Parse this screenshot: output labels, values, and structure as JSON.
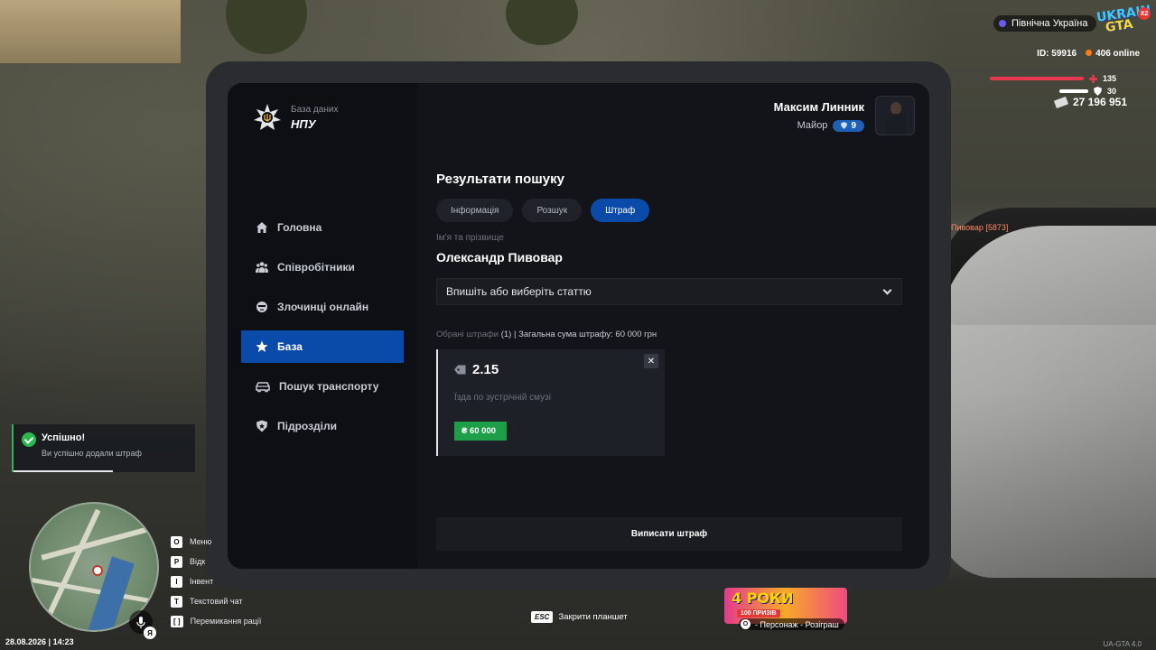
{
  "hud": {
    "region": "Північна Україна",
    "logo_line1": "UKRAIN",
    "logo_line2": "GTA",
    "logo_badge": "X2",
    "player_id": "ID: 59916",
    "online": "406 online",
    "health": "135",
    "armor": "30",
    "money": "27 196 951",
    "npc_label": "Пивовар [5873]",
    "colors": {
      "health": "#e53950",
      "armor": "#ffffff",
      "online_dot": "#ff7a1a"
    }
  },
  "tablet": {
    "brand": {
      "small": "База даних",
      "big": "НПУ"
    },
    "user": {
      "name": "Максим Линник",
      "rank": "Майор",
      "level": "9"
    },
    "nav": [
      {
        "label": "Головна",
        "icon": "home-icon",
        "active": false
      },
      {
        "label": "Співробітники",
        "icon": "people-icon",
        "active": false
      },
      {
        "label": "Злочинці онлайн",
        "icon": "criminal-icon",
        "active": false
      },
      {
        "label": "База",
        "icon": "star-icon",
        "active": true
      },
      {
        "label": "Пошук транспорту",
        "icon": "car-icon",
        "active": false
      },
      {
        "label": "Підрозділи",
        "icon": "shield-icon",
        "active": false
      }
    ],
    "title": "Результати пошуку",
    "tabs": [
      {
        "label": "Інформація",
        "active": false
      },
      {
        "label": "Розшук",
        "active": false
      },
      {
        "label": "Штраф",
        "active": true
      }
    ],
    "name_label": "Ім'я та прізвище",
    "name_value": "Олександр Пивовар",
    "select_placeholder": "Впишіть або виберіть статтю",
    "summary": {
      "label": "Обрані штрафи",
      "count": "(1)",
      "total": " | Загальна сума штрафу: 60 000 грн"
    },
    "fines": [
      {
        "code": "2.15",
        "description": "Їзда по зустрічній смузі",
        "amount": "₴ 60 000",
        "close": "✕"
      }
    ],
    "submit_label": "Виписати штраф",
    "colors": {
      "accent": "#0a4aa8",
      "fine_amount": "#1e9e49"
    }
  },
  "toast": {
    "title": "Успішно!",
    "text": "Ви успішно додали штраф",
    "color": "#2db84d"
  },
  "keybinds": [
    {
      "key": "O",
      "label": "Меню"
    },
    {
      "key": "P",
      "label": "Відк"
    },
    {
      "key": "I",
      "label": "Інвент"
    },
    {
      "key": "T",
      "label": "Текстовий чат"
    },
    {
      "key": "[ ]",
      "label": "Перемикання рації"
    }
  ],
  "datetime": "28.08.2026 | 14:23",
  "mic_lang": "Я",
  "esc": {
    "key": "ESC",
    "label": "Закрити планшет"
  },
  "promo": {
    "title": "4 РОКИ",
    "sub": "100 ПРИЗІВ",
    "caption_key": "O",
    "caption": "- Персонаж - Розіграш"
  },
  "version": "UA-GTA 4.0"
}
